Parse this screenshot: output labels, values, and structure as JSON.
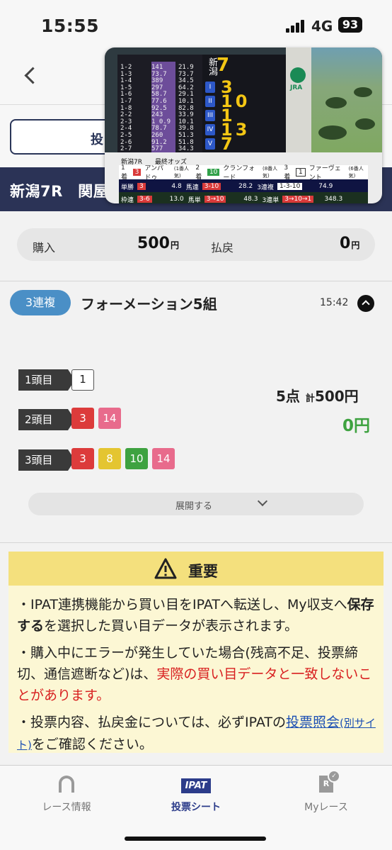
{
  "status_bar": {
    "time": "15:55",
    "network": "4G",
    "battery": "93"
  },
  "subbar": {
    "button_label": "投"
  },
  "race_band": {
    "race": "新潟7R　関屋"
  },
  "video": {
    "board_title": "新潟",
    "board_race": "7",
    "board_rows": [
      {
        "roman": "I",
        "value": "3"
      },
      {
        "roman": "II",
        "value": "10"
      },
      {
        "roman": "III",
        "value": "1"
      },
      {
        "roman": "IV",
        "value": "13"
      },
      {
        "roman": "V",
        "value": "7"
      }
    ],
    "odds_left": "1-2\n1-3\n1-4\n1-5\n1-6\n1-7\n1-8\n2-2\n2-3\n2-4\n2-5\n2-6\n2-7\n2-8",
    "odds_mid": "141\n73.7\n389\n297\n58.7\n77.6\n92.5\n243\n1 0.9\n78.7\n260\n91.2\n577",
    "odds_right": "21.9\n73.7\n34.5\n64.2\n29.1\n10.1\n82.8\n33.9\n10.1\n39.8\n51.3\n51.8\n34.3",
    "jra": "JRA",
    "strip_header": "新潟7R　　最終オッズ",
    "strip_horses": [
      {
        "place": "1着",
        "num": "3",
        "name": "アンパドゥ",
        "pop": "(1番人気)"
      },
      {
        "place": "2着",
        "num": "10",
        "name": "クランフォード",
        "pop": "(8番人気)"
      },
      {
        "place": "3着",
        "num": "1",
        "name": "ファーヴェント",
        "pop": "(6番人気)"
      }
    ],
    "strip_row1": [
      {
        "type": "単勝",
        "combo": "3",
        "odds": "4.8"
      },
      {
        "type": "馬連",
        "combo": "3-10",
        "odds": "28.2"
      },
      {
        "type": "3連複",
        "combo": "1-3-10",
        "odds": "74.9"
      }
    ],
    "strip_row2": [
      {
        "type": "枠連",
        "combo": "3-6",
        "odds": "13.0"
      },
      {
        "type": "馬単",
        "combo": "3→10",
        "odds": "48.3"
      },
      {
        "type": "3連単",
        "combo": "3→10→1",
        "odds": "348.3"
      }
    ]
  },
  "summary": {
    "purchase_label": "購入",
    "purchase_amount": "500",
    "payout_label": "払戻",
    "payout_amount": "0",
    "yen": "円"
  },
  "bet": {
    "tag": "3連複",
    "title": "フォーメーション5組",
    "time": "15:42",
    "positions": [
      {
        "label": "1頭目",
        "numbers": [
          {
            "n": "1",
            "color": "white"
          }
        ]
      },
      {
        "label": "2頭目",
        "numbers": [
          {
            "n": "3",
            "color": "red"
          },
          {
            "n": "14",
            "color": "pink"
          }
        ]
      },
      {
        "label": "3頭目",
        "numbers": [
          {
            "n": "3",
            "color": "red"
          },
          {
            "n": "8",
            "color": "yellow"
          },
          {
            "n": "10",
            "color": "green"
          },
          {
            "n": "14",
            "color": "pink"
          }
        ]
      }
    ],
    "points": "5点",
    "total_prefix": "計",
    "total": "500円",
    "payout": "0円",
    "expand_label": "展開する"
  },
  "notice": {
    "title": "重要",
    "p1_a": "・IPAT連携機能から買い目をIPATへ転送し、My収支へ",
    "p1_strong": "保存する",
    "p1_b": "を選択した買い目データが表示されます。",
    "p2_a": "・購入中にエラーが発生していた場合(残高不足、投票締切、通信遮断など)は、",
    "p2_red": "実際の買い目データと一致しないことがあります。",
    "p3_a": "・投票内容、払戻金については、必ずIPATの",
    "p3_link": "投票照会",
    "p3_link_small": "(別サイト)",
    "p3_b": "をご確認ください。"
  },
  "tabs": [
    {
      "label": "レース情報",
      "icon": "horseshoe-icon"
    },
    {
      "label": "投票シート",
      "icon": "ipat-icon",
      "icon_text": "IPAT"
    },
    {
      "label": "Myレース",
      "icon": "myrace-icon",
      "icon_text": "R"
    }
  ],
  "colors": {
    "navy": "#2b3356",
    "accent_blue": "#4a8fc6",
    "payout_green": "#3ea240",
    "notice_bg": "#fcf7d4"
  }
}
